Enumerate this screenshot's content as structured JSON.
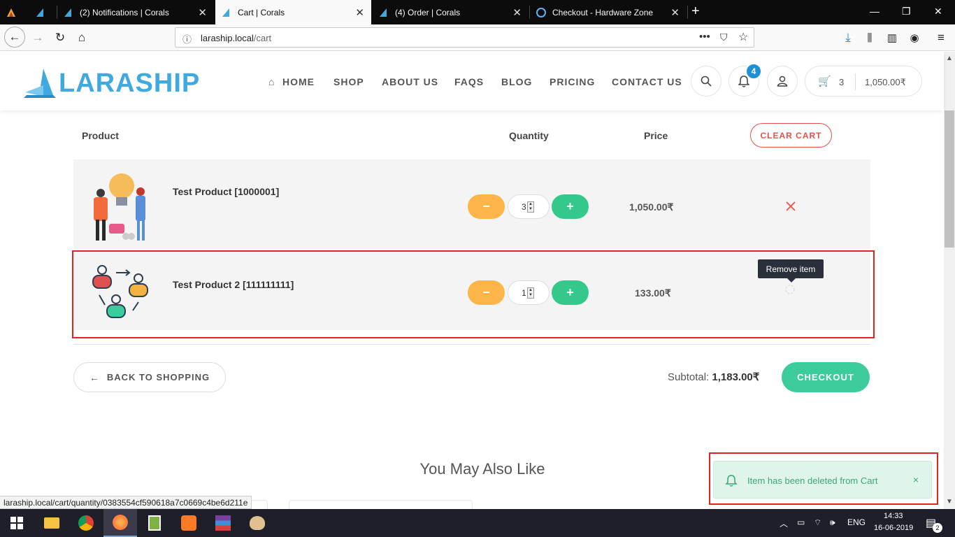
{
  "browser": {
    "tabs": [
      {
        "label": ""
      },
      {
        "label": ""
      },
      {
        "label": "(2) Notifications | Corals"
      },
      {
        "label": "Cart | Corals"
      },
      {
        "label": "(4) Order | Corals"
      },
      {
        "label": "Checkout - Hardware Zone"
      }
    ],
    "new_tab": "+",
    "url_host": "laraship.local",
    "url_path": "/cart",
    "status_url": "laraship.local/cart/quantity/0383554cf590618a7c0669c4be6d211e"
  },
  "site": {
    "logo": "LARASHIP",
    "menu": [
      "HOME",
      "SHOP",
      "ABOUT US",
      "FAQS",
      "BLOG",
      "PRICING",
      "CONTACT US"
    ],
    "notification_count": "4",
    "cart_count": "3",
    "cart_total": "1,050.00₹"
  },
  "cart": {
    "headers": {
      "product": "Product",
      "quantity": "Quantity",
      "price": "Price"
    },
    "clear_cart": "CLEAR CART",
    "items": [
      {
        "name": "Test Product [1000001]",
        "qty": "3",
        "price": "1,050.00₹"
      },
      {
        "name": "Test Product 2 [111111111]",
        "qty": "1",
        "price": "133.00₹"
      }
    ],
    "minus": "−",
    "plus": "+",
    "tooltip": "Remove item",
    "back": "BACK TO SHOPPING",
    "subtotal_label": "Subtotal:",
    "subtotal_value": "1,183.00₹",
    "checkout": "CHECKOUT"
  },
  "also_like": "You May Also Like",
  "toast": {
    "message": "Item has been deleted from Cart"
  },
  "taskbar": {
    "lang": "ENG",
    "time": "14:33",
    "date": "16-06-2019",
    "notif": "2"
  },
  "colors": {
    "brand": "#3fa9e0",
    "minus": "#fdb54a",
    "plus": "#34c98a",
    "danger": "#e8504a",
    "highlight": "#e02424"
  }
}
